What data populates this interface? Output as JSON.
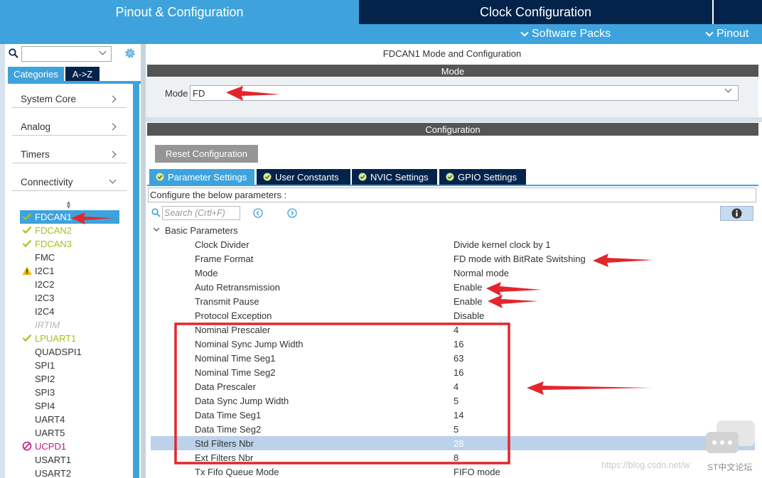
{
  "top_tabs": {
    "pinout": "Pinout & Configuration",
    "clock": "Clock Configuration"
  },
  "sub_menu": {
    "software_packs": "Software Packs",
    "pinout": "Pinout"
  },
  "sidebar": {
    "search_value": "",
    "tabs": {
      "categories": "Categories",
      "az": "A->Z"
    },
    "categories": [
      {
        "label": "System Core"
      },
      {
        "label": "Analog"
      },
      {
        "label": "Timers"
      },
      {
        "label": "Connectivity"
      }
    ],
    "peripherals": [
      {
        "label": "FDCAN1",
        "status": "selected-check"
      },
      {
        "label": "FDCAN2",
        "status": "check"
      },
      {
        "label": "FDCAN3",
        "status": "check"
      },
      {
        "label": "FMC",
        "status": "none"
      },
      {
        "label": "I2C1",
        "status": "warning"
      },
      {
        "label": "I2C2",
        "status": "none"
      },
      {
        "label": "I2C3",
        "status": "none"
      },
      {
        "label": "I2C4",
        "status": "none"
      },
      {
        "label": "IRTIM",
        "status": "disabled"
      },
      {
        "label": "LPUART1",
        "status": "check"
      },
      {
        "label": "QUADSPI1",
        "status": "none"
      },
      {
        "label": "SPI1",
        "status": "none"
      },
      {
        "label": "SPI2",
        "status": "none"
      },
      {
        "label": "SPI3",
        "status": "none"
      },
      {
        "label": "SPI4",
        "status": "none"
      },
      {
        "label": "UART4",
        "status": "none"
      },
      {
        "label": "UART5",
        "status": "none"
      },
      {
        "label": "UCPD1",
        "status": "blocked"
      },
      {
        "label": "USART1",
        "status": "none"
      },
      {
        "label": "USART2",
        "status": "none"
      }
    ]
  },
  "main": {
    "title": "FDCAN1 Mode and Configuration",
    "mode_header": "Mode",
    "mode_label": "Mode",
    "mode_value": "FD",
    "config_header": "Configuration",
    "reset_button": "Reset Configuration",
    "config_tabs": [
      {
        "label": "Parameter Settings",
        "active": true
      },
      {
        "label": "User Constants",
        "active": false
      },
      {
        "label": "NVIC Settings",
        "active": false
      },
      {
        "label": "GPIO Settings",
        "active": false
      }
    ],
    "configure_text": "Configure the below parameters :",
    "search_placeholder": "Search (Crtl+F)",
    "basic_group": "Basic Parameters",
    "parameters": [
      {
        "name": "Clock Divider",
        "value": "Divide kernel clock by 1"
      },
      {
        "name": "Frame Format",
        "value": "FD mode with BitRate Switshing"
      },
      {
        "name": "Mode",
        "value": "Normal mode"
      },
      {
        "name": "Auto Retransmission",
        "value": "Enable"
      },
      {
        "name": "Transmit Pause",
        "value": "Enable"
      },
      {
        "name": "Protocol Exception",
        "value": "Disable"
      },
      {
        "name": "Nominal Prescaler",
        "value": "4"
      },
      {
        "name": "Nominal Sync Jump Width",
        "value": "16"
      },
      {
        "name": "Nominal Time Seg1",
        "value": "63"
      },
      {
        "name": "Nominal Time Seg2",
        "value": "16"
      },
      {
        "name": "Data Prescaler",
        "value": "4"
      },
      {
        "name": "Data Sync Jump Width",
        "value": "5"
      },
      {
        "name": "Data Time Seg1",
        "value": "14"
      },
      {
        "name": "Data Time Seg2",
        "value": "5"
      },
      {
        "name": "Std Filters Nbr",
        "value": "28",
        "highlighted": true
      },
      {
        "name": "Ext Filters Nbr",
        "value": "8"
      },
      {
        "name": "Tx Fifo Queue Mode",
        "value": "FIFO mode"
      }
    ]
  },
  "watermark": {
    "url": "https://blog.csdn.net/w",
    "brand": "ST中文论坛"
  },
  "colors": {
    "accent_blue": "#3ea3dc",
    "navy": "#03234b",
    "annotation_red": "#e3262c",
    "lime_check": "#a3c418"
  }
}
